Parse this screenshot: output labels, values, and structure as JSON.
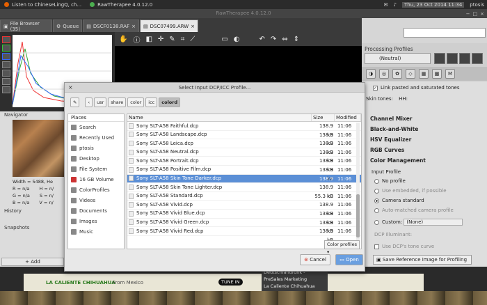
{
  "topbar": {
    "items": [
      {
        "label": "Listen to ChineseLingQ, ch...",
        "icon": "firefox-icon"
      },
      {
        "label": "RawTherapee 4.0.12.0",
        "icon": "chrome-icon"
      },
      {
        "label": "Raw Therapee 4.0.12.0",
        "icon": "app-icon"
      }
    ],
    "datetime": "Thu, 23 Oct 2014 11:34",
    "user": "ptosis"
  },
  "app": {
    "title": "RawTherapee 4.0.12.0",
    "tabs": [
      {
        "label": "File Browser (35)",
        "icon": "folder-icon"
      },
      {
        "label": "Queue",
        "icon": "gear-icon"
      },
      {
        "label": "DSCF0138.RAF",
        "icon": "image-icon"
      },
      {
        "label": "DSC07499.ARW",
        "icon": "image-icon"
      }
    ]
  },
  "navigator": {
    "title": "Navigator",
    "width_label": "Width = 5488, He",
    "r": "R = n/a",
    "g": "G = n/a",
    "b": "B = n/a",
    "h": "H = n/",
    "s": "S = n/",
    "v": "V = n/"
  },
  "left_sections": {
    "history": "History",
    "snapshots": "Snapshots",
    "add": "Add"
  },
  "right_panel": {
    "processing_profiles": "Processing Profiles",
    "profile_value": "(Neutral)",
    "link_label": "Link pasted and saturated tones",
    "skin_label": "Skin tones:",
    "skin_value": "HH:",
    "tools": [
      "Channel Mixer",
      "Black-and-White",
      "HSV Equalizer",
      "RGB Curves",
      "Color Management"
    ],
    "input_profile_label": "Input Profile",
    "no_profile": "No profile",
    "use_embedded": "Use embedded, if possible",
    "camera_standard": "Camera standard",
    "auto_matched": "Auto-matched camera profile",
    "custom_label": "Custom:",
    "custom_value": "(None)",
    "dcp_illuminant": "DCP Illuminant:",
    "use_dcp_tone": "Use DCP's tone curve",
    "save_reference": "Save Reference Image for Profiling"
  },
  "dialog": {
    "title": "Select Input DCP/ICC Profile...",
    "path": [
      "usr",
      "share",
      "color",
      "icc",
      "colord"
    ],
    "places_header": "Places",
    "places": [
      {
        "label": "Search",
        "icon": "search-icon"
      },
      {
        "label": "Recently Used",
        "icon": "clock-icon"
      },
      {
        "label": "ptosis",
        "icon": "home-icon"
      },
      {
        "label": "Desktop",
        "icon": "desktop-icon"
      },
      {
        "label": "File System",
        "icon": "drive-icon"
      },
      {
        "label": "16 GB Volume",
        "icon": "volume-icon"
      },
      {
        "label": "ColorProfiles",
        "icon": "folder-icon"
      },
      {
        "label": "Videos",
        "icon": "video-folder-icon"
      },
      {
        "label": "Documents",
        "icon": "documents-folder-icon"
      },
      {
        "label": "Images",
        "icon": "images-folder-icon"
      },
      {
        "label": "Music",
        "icon": "music-folder-icon"
      }
    ],
    "columns": {
      "name": "Name",
      "size": "Size",
      "modified": "Modified"
    },
    "files": [
      {
        "name": "Sony SLT-A58 Faithful.dcp",
        "size": "138.9 kB",
        "modified": "11:06"
      },
      {
        "name": "Sony SLT-A58 Landscape.dcp",
        "size": "138.9 kB",
        "modified": "11:06"
      },
      {
        "name": "Sony SLT-A58 Leica.dcp",
        "size": "138.9 kB",
        "modified": "11:06"
      },
      {
        "name": "Sony SLT-A58 Neutral.dcp",
        "size": "138.9 kB",
        "modified": "11:06"
      },
      {
        "name": "Sony SLT-A58 Portrait.dcp",
        "size": "138.9 kB",
        "modified": "11:06"
      },
      {
        "name": "Sony SLT-A58 Positive Film.dcp",
        "size": "138.9 kB",
        "modified": "11:06"
      },
      {
        "name": "Sony SLT-A58 Skin Tone Darker.dcp",
        "size": "138.9 kB",
        "modified": "11:06",
        "selected": true
      },
      {
        "name": "Sony SLT-A58 Skin Tone Lighter.dcp",
        "size": "138.9 kB",
        "modified": "11:06"
      },
      {
        "name": "Sony SLT-A58 Standard.dcp",
        "size": "55.3 kB",
        "modified": "11:06"
      },
      {
        "name": "Sony SLT-A58 Vivid.dcp",
        "size": "138.9 kB",
        "modified": "11:06"
      },
      {
        "name": "Sony SLT-A58 Vivid Blue.dcp",
        "size": "138.9 kB",
        "modified": "11:06"
      },
      {
        "name": "Sony SLT-A58 Vivid Green.dcp",
        "size": "138.9 kB",
        "modified": "11:06"
      },
      {
        "name": "Sony SLT-A58 Vivid Red.dcp",
        "size": "138.9 kB",
        "modified": "11:06"
      }
    ],
    "filter": "Color profiles",
    "cancel": "Cancel",
    "open": "Open"
  },
  "background_web": {
    "station": "LA CALIENTE CHIHUAHUA",
    "from": "From Mexico",
    "tune_in": "TUNE IN",
    "side_items": [
      "Deutschlandfunk -",
      "PreSales Marketing",
      "La Caliente Chihuahua"
    ]
  },
  "colors": {
    "selected_row": "#5b8fd6",
    "open_button": "#4a88d6",
    "cancel_icon": "#d33a2c"
  }
}
